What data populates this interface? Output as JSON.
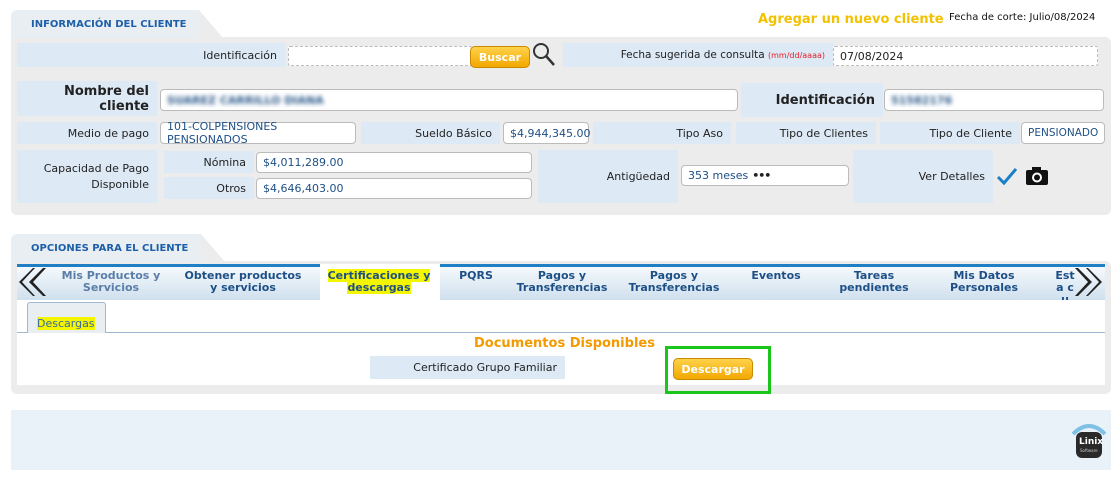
{
  "client_info": {
    "section_title": "INFORMACIÓN DEL CLIENTE",
    "add_client": "Agregar un nuevo cliente",
    "cutoff_date": "Fecha de corte: Julio/08/2024",
    "identificacion_label": "Identificación",
    "identificacion_value": "",
    "buscar_button": "Buscar",
    "fecha_label": "Fecha sugerida de consulta",
    "fecha_format": "(mm/dd/aaaa)",
    "fecha_value": "07/08/2024",
    "nombre_label": "Nombre del cliente",
    "nombre_value": "SUAREZ CARRILLO DIANA",
    "identificacion2_label": "Identificación",
    "identificacion2_value": "51582176",
    "medio_pago_label": "Medio de pago",
    "medio_pago_value": "101-COLPENSIONES PENSIONADOS",
    "sueldo_label": "Sueldo Básico",
    "sueldo_value": "$4,944,345.00",
    "tipo_aso_label": "Tipo Aso",
    "tipo_clientes_label": "Tipo de Clientes",
    "tipo_cliente_label": "Tipo de Cliente",
    "tipo_cliente_value": "PENSIONADO",
    "capacidad_label": "Capacidad de Pago Disponible",
    "nomina_label": "Nómina",
    "nomina_value": "$4,011,289.00",
    "otros_label": "Otros",
    "otros_value": "$4,646,403.00",
    "antiguedad_label": "Antigüedad",
    "antiguedad_value": "353 meses",
    "ver_detalles_label": "Ver Detalles"
  },
  "client_options": {
    "section_title": "OPCIONES PARA EL CLIENTE",
    "tabs": [
      {
        "label": "Mis Productos y Servicios"
      },
      {
        "label": "Obtener productos y servicios"
      },
      {
        "label": "Certificaciones y descargas"
      },
      {
        "label": "PQRS"
      },
      {
        "label": "Pagos y Transferencias"
      },
      {
        "label": "Pagos y Transferencias"
      },
      {
        "label": "Eventos"
      },
      {
        "label": "Tareas pendientes"
      },
      {
        "label": "Mis Datos Personales"
      },
      {
        "label": "Esta cu"
      }
    ],
    "subtab_label": "Descargas",
    "documents_title": "Documentos Disponibles",
    "doc_name": "Certificado Grupo Familiar",
    "download_button": "Descargar"
  },
  "footer": {
    "logo_text": "Linix",
    "logo_subtext": "Software"
  },
  "colors": {
    "accent_blue": "#1d5fa8",
    "label_bg": "#dde9f5",
    "gold": "#f2a800",
    "orange_title": "#f29a00",
    "highlight_green": "#19c619",
    "highlight_yellow": "#f4f500"
  }
}
